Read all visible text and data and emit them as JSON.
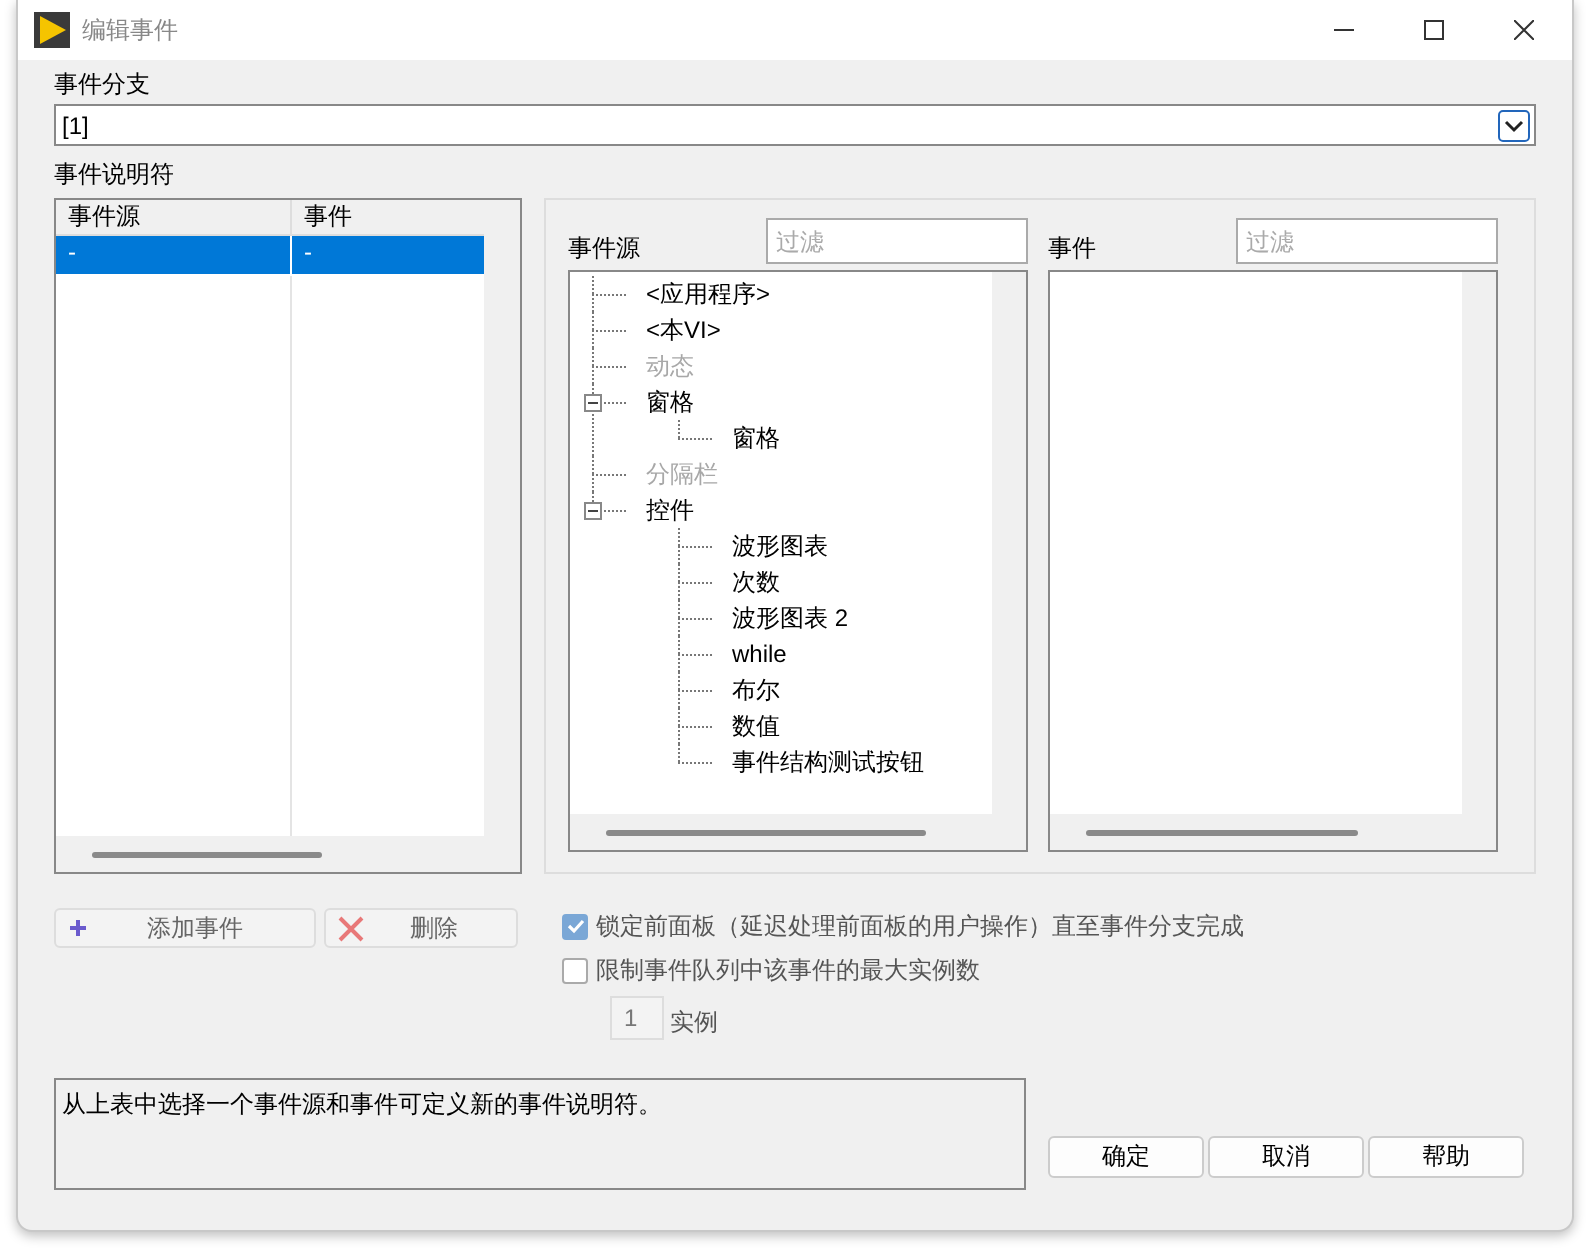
{
  "window": {
    "title": "编辑事件"
  },
  "event_case": {
    "label": "事件分支",
    "value": "[1]"
  },
  "specifiers": {
    "label": "事件说明符",
    "columns": [
      "事件源",
      "事件"
    ],
    "rows": [
      {
        "cells": [
          "-",
          "-"
        ],
        "selected": true
      }
    ]
  },
  "event_sources": {
    "label": "事件源",
    "filter_placeholder": "过滤",
    "tree": [
      {
        "label": "<应用程序>",
        "disabled": false
      },
      {
        "label": "<本VI>",
        "disabled": false
      },
      {
        "label": "动态",
        "disabled": true
      },
      {
        "label": "窗格",
        "disabled": false,
        "expanded": true,
        "children": [
          {
            "label": "窗格",
            "disabled": false
          }
        ]
      },
      {
        "label": "分隔栏",
        "disabled": true
      },
      {
        "label": "控件",
        "disabled": false,
        "expanded": true,
        "children": [
          {
            "label": "波形图表",
            "disabled": false
          },
          {
            "label": "次数",
            "disabled": false
          },
          {
            "label": "波形图表 2",
            "disabled": false
          },
          {
            "label": "while",
            "disabled": false
          },
          {
            "label": "布尔",
            "disabled": false
          },
          {
            "label": "数值",
            "disabled": false
          },
          {
            "label": "事件结构测试按钮",
            "disabled": false
          }
        ]
      }
    ]
  },
  "events": {
    "label": "事件",
    "filter_placeholder": "过滤"
  },
  "actions": [
    {
      "kind": "add",
      "label": "添加事件",
      "disabled": true
    },
    {
      "kind": "delete",
      "label": "删除",
      "disabled": true
    }
  ],
  "options": [
    {
      "label": "锁定前面板（延迟处理前面板的用户操作）直至事件分支完成",
      "checked": true,
      "disabled": true
    },
    {
      "label": "限制事件队列中该事件的最大实例数",
      "checked": false,
      "disabled": true
    }
  ],
  "instances": {
    "value": "1",
    "label": "实例"
  },
  "description": "从上表中选择一个事件源和事件可定义新的事件说明符。",
  "buttons": [
    "确定",
    "取消",
    "帮助"
  ]
}
